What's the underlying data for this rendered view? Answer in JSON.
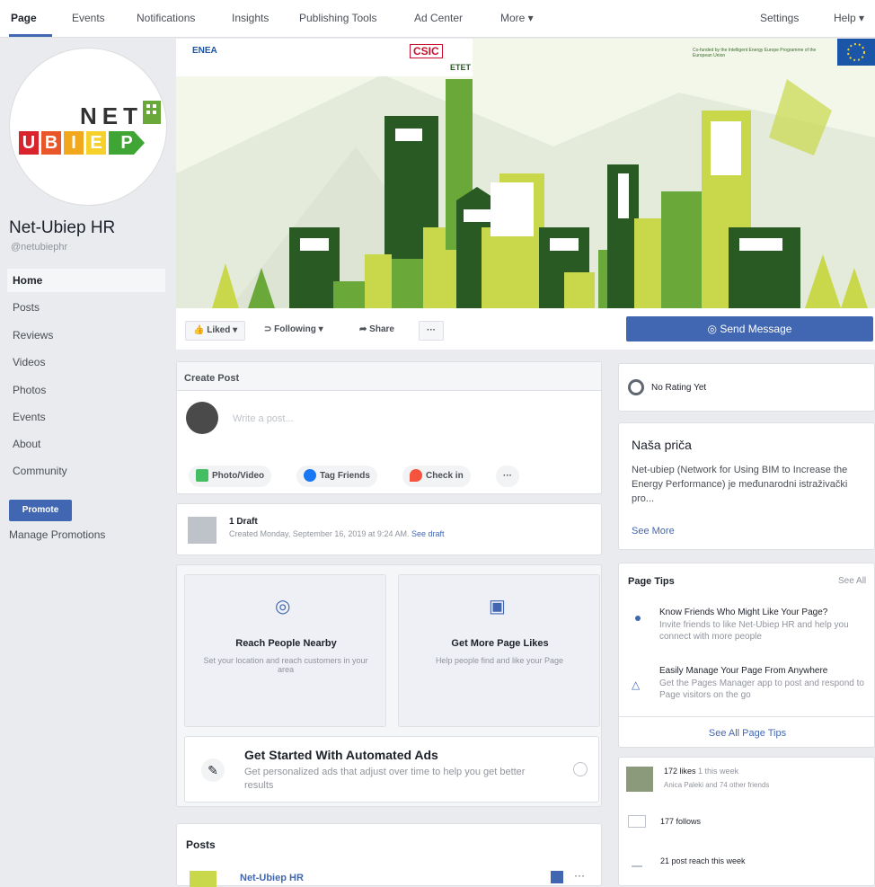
{
  "topbar": {
    "tabs": [
      "Page",
      "Events",
      "Notifications",
      "Insights",
      "Publishing Tools",
      "Ad Center",
      "More ▾"
    ],
    "settings": "Settings",
    "help": "Help ▾"
  },
  "sidebar": {
    "name": "Net-Ubiep HR",
    "handle": "@netubiephr",
    "logo_top": "NET",
    "logo_letters": [
      "U",
      "B",
      "I",
      "E",
      "P"
    ],
    "items": [
      "Home",
      "Posts",
      "Reviews",
      "Videos",
      "Photos",
      "Events",
      "About",
      "Community"
    ],
    "promote": "Promote",
    "manage": "Manage Promotions"
  },
  "cover": {
    "org_logos": [
      "ENEA",
      "CSIC",
      "ETET"
    ],
    "funding_note": "Co-funded by the Intelligent Energy Europe Programme of the European Union"
  },
  "actions": {
    "liked": "Liked ▾",
    "following": "Following ▾",
    "share": "Share",
    "more": "···",
    "send_message": "Send Message"
  },
  "create_post": {
    "title": "Create Post",
    "placeholder": "Write a post...",
    "photo": "Photo/Video",
    "tag": "Tag Friends",
    "checkin": "Check in",
    "more": "···"
  },
  "draft": {
    "title": "1 Draft",
    "text": "Created Monday, September 16, 2019 at 9:24 AM.",
    "link": "See draft"
  },
  "promo_cards": [
    {
      "title": "Reach People Nearby",
      "text": "Set your location and reach customers in your area"
    },
    {
      "title": "Get More Page Likes",
      "text": "Help people find and like your Page"
    }
  ],
  "auto_ads": {
    "title": "Get Started With Automated Ads",
    "text": "Get personalized ads that adjust over time to help you get better results"
  },
  "posts": {
    "title": "Posts",
    "author": "Net-Ubiep HR"
  },
  "rating": {
    "text": "No Rating Yet"
  },
  "story": {
    "title": "Naša priča",
    "text": "Net-ubiep (Network for Using BIM to Increase the Energy Performance) je međunarodni istraživački pro...",
    "more": "See More"
  },
  "tips": {
    "title": "Page Tips",
    "see_all": "See All",
    "items": [
      {
        "title": "Know Friends Who Might Like Your Page?",
        "text": "Invite friends to like Net-Ubiep HR and help you connect with more people"
      },
      {
        "title": "Easily Manage Your Page From Anywhere",
        "text": "Get the Pages Manager app to post and respond to Page visitors on the go"
      }
    ],
    "see_all_tips": "See All Page Tips"
  },
  "stats": {
    "likes": "172 likes",
    "likes_sub": "Anica Paleki and 74 other friends",
    "likes_week": "1 this week",
    "follows": "177 follows",
    "reach": "21 post reach this week"
  },
  "colors": {
    "accent": "#4267b2",
    "green_dark": "#2a5a24",
    "green": "#6aa83a",
    "green_light": "#c9d84a"
  }
}
